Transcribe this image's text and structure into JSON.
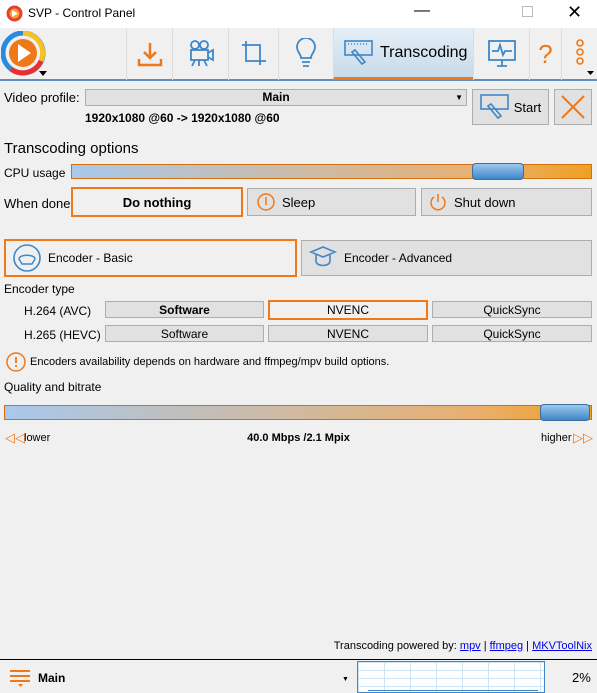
{
  "window": {
    "title": "SVP - Control Panel"
  },
  "toolbar": {
    "tabs": [
      {
        "icon": "download-icon"
      },
      {
        "icon": "video-camera-icon"
      },
      {
        "icon": "crop-icon"
      },
      {
        "icon": "lightbulb-icon"
      },
      {
        "label": "Transcoding",
        "icon": "transcoding-icon",
        "active": true
      },
      {
        "icon": "monitor-icon"
      },
      {
        "icon": "help-icon",
        "label": "?"
      },
      {
        "icon": "more-icon"
      }
    ]
  },
  "profile": {
    "label": "Video profile:",
    "value": "Main",
    "info": "1920x1080 @60 -> 1920x1080 @60",
    "start": "Start"
  },
  "transcoding": {
    "title": "Transcoding options",
    "cpu_label": "CPU usage",
    "cpu_level_percent": 82,
    "when_done_label": "When done",
    "when_done": [
      "Do nothing",
      "Sleep",
      "Shut down"
    ],
    "when_done_selected": "Do nothing"
  },
  "encoder": {
    "tabs": [
      "Encoder - Basic",
      "Encoder - Advanced"
    ],
    "type_label": "Encoder type",
    "rows": [
      {
        "name": "H.264 (AVC)",
        "options": [
          "Software",
          "NVENC",
          "QuickSync"
        ],
        "selected": "NVENC"
      },
      {
        "name": "H.265 (HEVC)",
        "options": [
          "Software",
          "NVENC",
          "QuickSync"
        ]
      }
    ],
    "note": "Encoders availability depends on hardware and ffmpeg/mpv build options."
  },
  "quality": {
    "title": "Quality and bitrate",
    "level_percent": 94,
    "lower": "lower",
    "higher": "higher",
    "value": "40.0 Mbps /2.1 Mpix"
  },
  "footer": {
    "powered": "Transcoding powered by:",
    "links": [
      "mpv",
      "ffmpeg",
      "MKVToolNix"
    ],
    "sep": "|"
  },
  "status": {
    "profile": "Main",
    "cpu": "2%"
  },
  "colors": {
    "accent": "#f07818",
    "blue": "#3f87c8"
  }
}
